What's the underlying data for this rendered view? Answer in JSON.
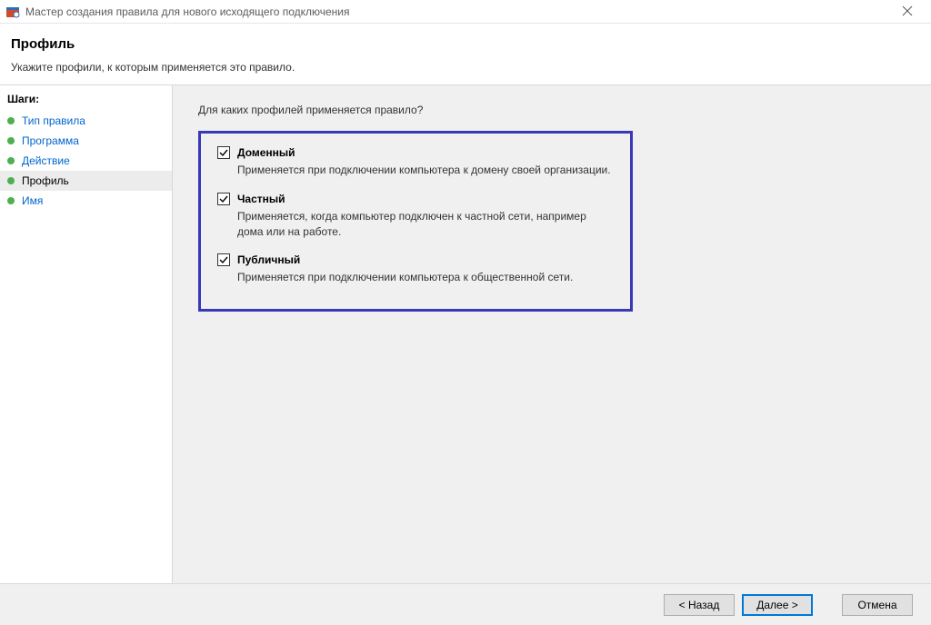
{
  "window": {
    "title": "Мастер создания правила для нового исходящего подключения"
  },
  "header": {
    "title": "Профиль",
    "subtitle": "Укажите профили, к которым применяется это правило."
  },
  "sidebar": {
    "steps_label": "Шаги:",
    "steps": [
      {
        "label": "Тип правила",
        "current": false
      },
      {
        "label": "Программа",
        "current": false
      },
      {
        "label": "Действие",
        "current": false
      },
      {
        "label": "Профиль",
        "current": true
      },
      {
        "label": "Имя",
        "current": false
      }
    ]
  },
  "content": {
    "question": "Для каких профилей применяется правило?",
    "options": [
      {
        "key": "domain",
        "checked": true,
        "label": "Доменный",
        "description": "Применяется при подключении компьютера к домену своей организации."
      },
      {
        "key": "private",
        "checked": true,
        "label": "Частный",
        "description": "Применяется, когда компьютер подключен к частной сети, например дома или на работе."
      },
      {
        "key": "public",
        "checked": true,
        "label": "Публичный",
        "description": "Применяется при подключении компьютера к общественной сети."
      }
    ]
  },
  "footer": {
    "back": "< Назад",
    "next": "Далее >",
    "cancel": "Отмена"
  }
}
